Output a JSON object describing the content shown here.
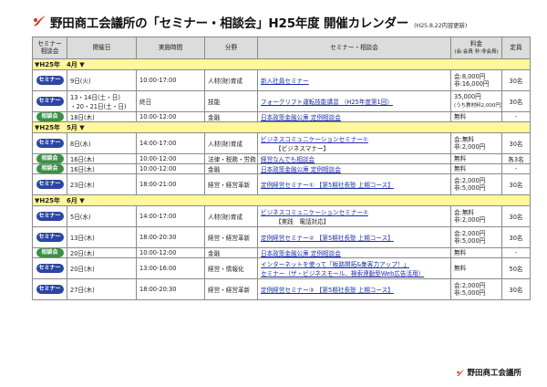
{
  "header": {
    "title": "野田商工会議所の「セミナー・相談会」H25年度 開催カレンダー",
    "updated": "(H25.8.22内容更新)"
  },
  "columns": {
    "category_line1": "セミナー",
    "category_line2": "相談会",
    "date": "開催日",
    "time": "実施時間",
    "field": "分野",
    "title": "セミナー・相談会",
    "fee": "料金",
    "fee_note": "(会:会員 非:非会員)",
    "capacity": "定員"
  },
  "badges": {
    "seminar": "セミナー",
    "consult": "相談会"
  },
  "months": [
    {
      "label": "▼H25年　4月 ▼",
      "rows": [
        {
          "type": "seminar",
          "date": [
            "9日(火)"
          ],
          "time": "10:00-17:00",
          "field": "人材(財)育成",
          "title": [
            "新入社員セミナー"
          ],
          "fee": [
            "会:8,000円",
            "非:16,000円"
          ],
          "capacity": "30名"
        },
        {
          "type": "seminar",
          "date": [
            "13・14日(土・日)",
            "・20・21日(土・日)"
          ],
          "time": "終日",
          "field": "技能",
          "title": [
            "フォークリフト運転技能講習 （H25年度第1回）"
          ],
          "fee": [
            "35,000円",
            "(うち教材料2,000円)"
          ],
          "capacity": "30名"
        },
        {
          "type": "consult",
          "date": [
            "18日(木)"
          ],
          "time": "10:00-12:00",
          "field": "金融",
          "title": [
            "日本政策金融公庫 定例相談会"
          ],
          "fee": [
            "無料"
          ],
          "capacity": "-"
        }
      ]
    },
    {
      "label": "▼H25年　5月 ▼",
      "rows": [
        {
          "type": "seminar",
          "date": [
            "8日(水)"
          ],
          "time": "14:00-17:00",
          "field": "人材(財)育成",
          "title": [
            "ビジネスコミュニケーションセミナー①",
            "【ビジネスマナー】"
          ],
          "fee": [
            "会:無料",
            "非:2,000円"
          ],
          "capacity": "30名"
        },
        {
          "type": "consult",
          "date": [
            "16日(木)"
          ],
          "time": "10:00-12:00",
          "field": "法律・税務・労務",
          "title": [
            "経営なんでも相談会"
          ],
          "fee": [
            "無料"
          ],
          "capacity": "各3名"
        },
        {
          "type": "consult",
          "date": [
            "16日(木)"
          ],
          "time": "10:00-12:00",
          "field": "金融",
          "title": [
            "日本政策金融公庫 定例相談会"
          ],
          "fee": [
            "無料"
          ],
          "capacity": "-"
        },
        {
          "type": "seminar",
          "date": [
            "23日(木)"
          ],
          "time": "18:00-21:00",
          "field": "経営・経営革新",
          "title": [
            "定例経営セミナー① 【第5期社長塾 上期コース】"
          ],
          "fee": [
            "会:2,000円",
            "非:5,000円"
          ],
          "capacity": "30名"
        }
      ]
    },
    {
      "label": "▼H25年　6月 ▼",
      "rows": [
        {
          "type": "seminar",
          "date": [
            "5日(水)"
          ],
          "time": "14:00-17:00",
          "field": "人材(財)育成",
          "title": [
            "ビジネスコミュニケーションセミナー②",
            "【実践　電話対応】"
          ],
          "fee": [
            "会:無料",
            "非:2,000円"
          ],
          "capacity": "30名"
        },
        {
          "type": "seminar",
          "date": [
            "13日(木)"
          ],
          "time": "18:00-20:30",
          "field": "経営・経営革新",
          "title": [
            "定例経営セミナー② 【第5期社長塾 上期コース】"
          ],
          "fee": [
            "会:2,000円",
            "非:5,000円"
          ],
          "capacity": "30名"
        },
        {
          "type": "consult",
          "date": [
            "20日(木)"
          ],
          "time": "10:00-12:00",
          "field": "金融",
          "title": [
            "日本政策金融公庫 定例相談会"
          ],
          "fee": [
            "無料"
          ],
          "capacity": "-"
        },
        {
          "type": "seminar",
          "date": [
            "20日(木)"
          ],
          "time": "13:00-16:00",
          "field": "経営・情報化",
          "title": [
            "インターネットを使って「販路開拓&集客力アップ！」",
            "セミナー（ザ・ビジネスモール、検索連動型Web広告活用）"
          ],
          "fee": [
            "無料"
          ],
          "capacity": "50名"
        },
        {
          "type": "seminar",
          "date": [
            "27日(木)"
          ],
          "time": "18:00-20:30",
          "field": "経営・経営革新",
          "title": [
            "定例経営セミナー③ 【第5期社長塾 上期コース】"
          ],
          "fee": [
            "会:2,000円",
            "非:5,000円"
          ],
          "capacity": "30名"
        }
      ]
    }
  ],
  "footer": {
    "org": "野田商工会議所"
  },
  "colors": {
    "seminar": "#2a46a2",
    "consult": "#3a9145",
    "month_band": "#fff79c",
    "header_bg": "#dcdcdc",
    "logo": "#d2361f"
  }
}
